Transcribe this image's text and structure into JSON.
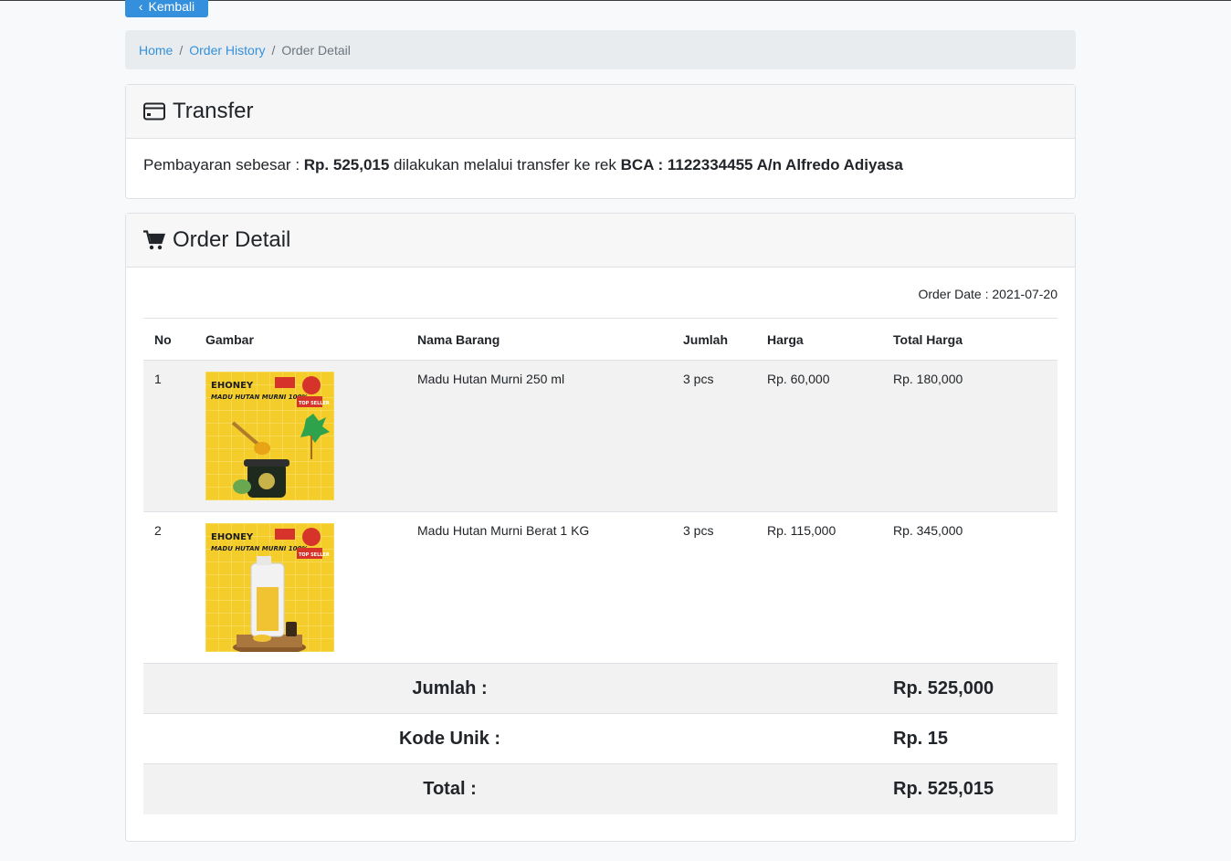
{
  "back_button": {
    "label": "Kembali"
  },
  "breadcrumb": {
    "home": "Home",
    "history": "Order History",
    "current": "Order Detail",
    "separator": "/"
  },
  "transfer": {
    "title": "Transfer",
    "text_prefix": "Pembayaran sebesar : ",
    "amount": "Rp. 525,015",
    "text_middle": " dilakukan melalui transfer ke rek ",
    "account": "BCA : 1122334455 A/n Alfredo Adiyasa"
  },
  "order": {
    "title": "Order Detail",
    "order_date": "Order Date : 2021-07-20",
    "columns": [
      "No",
      "Gambar",
      "Nama Barang",
      "Jumlah",
      "Harga",
      "Total Harga"
    ],
    "rows": [
      {
        "no": "1",
        "name": "Madu Hutan Murni 250 ml",
        "qty": "3 pcs",
        "price": "Rp. 60,000",
        "total": "Rp. 180,000",
        "img_brand": "EHONEY",
        "img_text": "MADU HUTAN MURNI 100%",
        "img_badge": "TOP SELLER"
      },
      {
        "no": "2",
        "name": "Madu Hutan Murni Berat 1 KG",
        "qty": "3 pcs",
        "price": "Rp. 115,000",
        "total": "Rp. 345,000",
        "img_brand": "EHONEY",
        "img_text": "MADU HUTAN MURNI 100%",
        "img_badge": "TOP SELLER"
      }
    ],
    "summary": {
      "jumlah_label": "Jumlah :",
      "jumlah_value": "Rp. 525,000",
      "kode_label": "Kode Unik :",
      "kode_value": "Rp. 15",
      "total_label": "Total :",
      "total_value": "Rp. 525,015"
    }
  },
  "colors": {
    "primary": "#3490dc",
    "striped": "#f2f2f2",
    "product_bg": "#f4cd2a"
  },
  "icons": {
    "back": "chevron-left-icon",
    "transfer": "credit-card-icon",
    "order": "shopping-cart-icon"
  }
}
